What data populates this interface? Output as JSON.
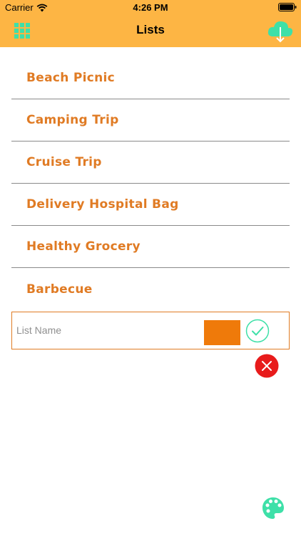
{
  "status_bar": {
    "carrier": "Carrier",
    "time": "4:26 PM"
  },
  "nav": {
    "title": "Lists",
    "left_icon": "grid-icon",
    "right_icon": "cloud-download-icon"
  },
  "lists": [
    {
      "name": "Beach Picnic"
    },
    {
      "name": "Camping Trip"
    },
    {
      "name": "Cruise Trip"
    },
    {
      "name": "Delivery Hospital Bag"
    },
    {
      "name": "Healthy Grocery"
    },
    {
      "name": "Barbecue"
    }
  ],
  "new_list": {
    "placeholder": "List Name",
    "value": "",
    "selected_color": "#ef7a0a",
    "confirm_icon": "checkmark-icon",
    "cancel_icon": "close-icon"
  },
  "footer": {
    "palette_icon": "palette-icon"
  },
  "colors": {
    "header": "#fdb544",
    "list_text": "#e07b24",
    "accent_green": "#3ee0a8",
    "cancel_red": "#e81b1b"
  }
}
